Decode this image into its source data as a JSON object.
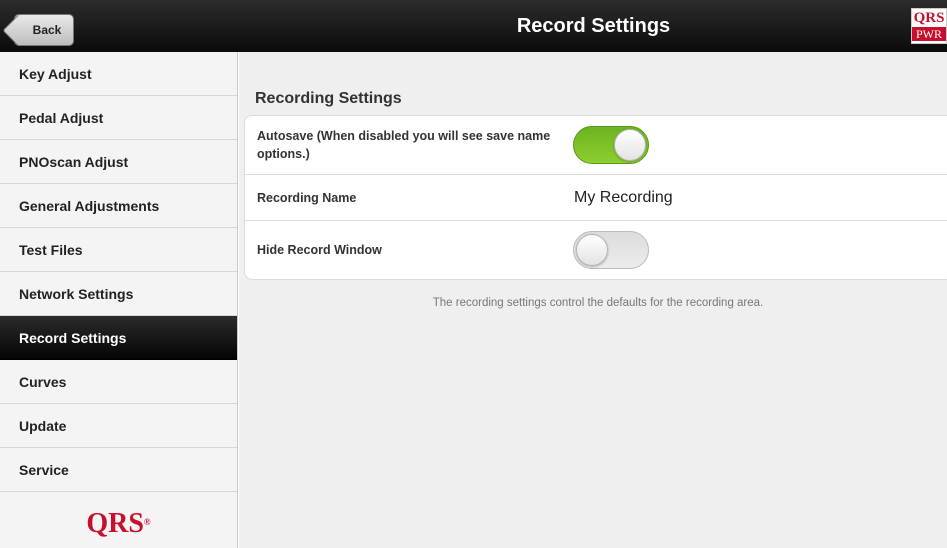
{
  "header": {
    "back_label": "Back",
    "title": "Record Settings",
    "logo_top": "QRS",
    "logo_bottom": "PWR"
  },
  "sidebar": {
    "items": [
      {
        "label": "Key Adjust",
        "active": false
      },
      {
        "label": "Pedal Adjust",
        "active": false
      },
      {
        "label": "PNOscan Adjust",
        "active": false
      },
      {
        "label": "General Adjustments",
        "active": false
      },
      {
        "label": "Test Files",
        "active": false
      },
      {
        "label": "Network Settings",
        "active": false
      },
      {
        "label": "Record Settings",
        "active": true
      },
      {
        "label": "Curves",
        "active": false
      },
      {
        "label": "Update",
        "active": false
      },
      {
        "label": "Service",
        "active": false
      }
    ],
    "logo": "QRS",
    "logo_mark": "®"
  },
  "main": {
    "section_title": "Recording Settings",
    "rows": [
      {
        "label": "Autosave (When disabled you will see save name options.)",
        "type": "toggle",
        "on": true
      },
      {
        "label": "Recording Name",
        "type": "text",
        "value": "My Recording"
      },
      {
        "label": "Hide Record Window",
        "type": "toggle",
        "on": false
      }
    ],
    "footnote": "The recording settings control the defaults for the recording area."
  },
  "colors": {
    "accent_green": "#7dc12a",
    "brand_red": "#c8102e",
    "bar_black": "#111111"
  }
}
